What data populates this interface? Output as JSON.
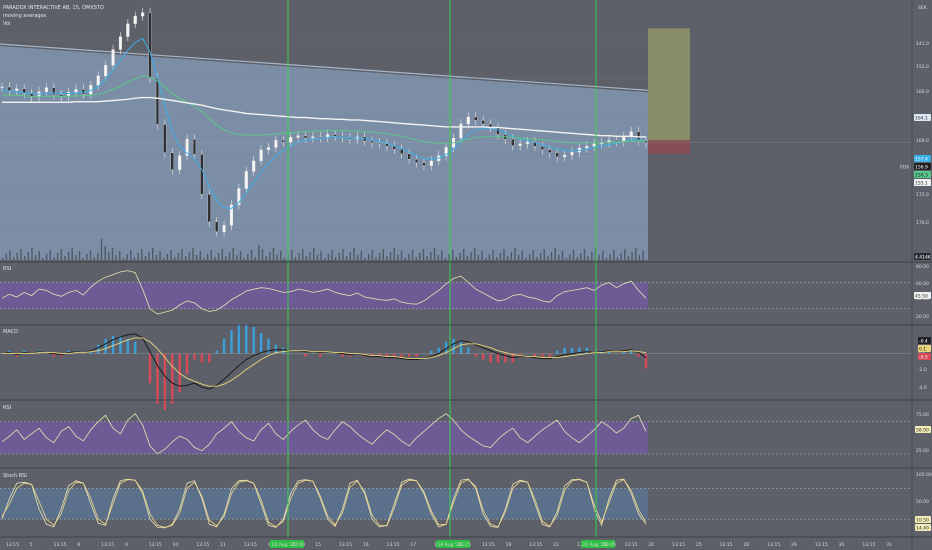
{
  "header": {
    "symbol_line": "PARADOX INTERACTIVE AB, 15, OMXSTO",
    "indicator_1": "moving averages",
    "indicator_2": "Vol",
    "currency": "SEK"
  },
  "chart_data": [
    {
      "pane": "price",
      "type": "candlestick",
      "ylim": [
        137,
        181
      ],
      "yticks": [
        140.0,
        152.0,
        160.0,
        168.0,
        176.0,
        176.0
      ],
      "ytick_labels": [
        "141.0",
        "152.0",
        "160.0",
        "168.0",
        "172.0",
        "176.0"
      ],
      "series": [
        {
          "name": "close",
          "values": [
            166.5,
            165.9,
            166.2,
            165.4,
            164.8,
            165.7,
            166.4,
            165.2,
            164.9,
            165.6,
            166.1,
            165.3,
            166.8,
            168.4,
            170.2,
            172.9,
            175.1,
            177.3,
            178.6,
            179.2,
            168.0,
            160.1,
            155.3,
            152.4,
            154.8,
            157.6,
            155.0,
            148.2,
            143.5,
            141.8,
            142.9,
            146.4,
            149.2,
            152.1,
            153.9,
            155.8,
            156.2,
            157.4,
            157.1,
            157.9,
            158.2,
            157.8,
            158.0,
            157.9,
            158.4,
            158.1,
            157.8,
            157.6,
            158.0,
            157.3,
            157.0,
            156.8,
            156.4,
            155.9,
            155.1,
            154.2,
            153.6,
            153.1,
            153.9,
            154.8,
            156.2,
            157.8,
            160.2,
            161.4,
            160.8,
            160.2,
            159.6,
            158.4,
            157.6,
            156.5,
            156.8,
            157.2,
            156.4,
            155.8,
            155.3,
            154.6,
            154.9,
            155.4,
            156.1,
            156.4,
            156.8,
            157.0,
            157.4,
            157.2,
            158.1,
            158.9,
            157.3,
            157.0
          ]
        },
        {
          "name": "ma_fast",
          "values": [
            166.0,
            165.8,
            165.7,
            165.5,
            165.4,
            165.3,
            165.4,
            165.5,
            165.4,
            165.4,
            165.5,
            165.6,
            165.9,
            166.6,
            167.8,
            169.4,
            171.0,
            172.8,
            174.1,
            174.8,
            172.5,
            168.2,
            163.4,
            159.0,
            156.4,
            155.2,
            154.3,
            152.4,
            149.5,
            147.2,
            145.9,
            145.8,
            146.8,
            148.5,
            150.3,
            152.0,
            153.5,
            154.8,
            155.7,
            156.5,
            157.1,
            157.4,
            157.6,
            157.7,
            157.9,
            158.0,
            157.9,
            157.8,
            157.8,
            157.7,
            157.5,
            157.2,
            156.9,
            156.5,
            156.0,
            155.4,
            154.8,
            154.3,
            154.2,
            154.4,
            155.0,
            155.9,
            157.2,
            158.4,
            159.2,
            159.5,
            159.5,
            159.2,
            158.7,
            158.1,
            157.6,
            157.3,
            157.0,
            156.7,
            156.3,
            155.9,
            155.7,
            155.6,
            155.7,
            155.9,
            156.2,
            156.4,
            156.7,
            156.9,
            157.2,
            157.6,
            157.5,
            157.3
          ]
        },
        {
          "name": "ma_mid",
          "values": [
            165.2,
            165.1,
            165.1,
            165.0,
            164.9,
            164.9,
            164.9,
            164.9,
            164.9,
            164.9,
            165.0,
            165.0,
            165.1,
            165.3,
            165.6,
            166.1,
            166.6,
            167.3,
            167.9,
            168.4,
            168.2,
            167.5,
            166.5,
            165.4,
            164.5,
            163.9,
            163.2,
            162.3,
            161.1,
            160.0,
            159.2,
            158.7,
            158.4,
            158.3,
            158.3,
            158.3,
            158.4,
            158.5,
            158.6,
            158.7,
            158.8,
            158.9,
            159.0,
            159.0,
            159.1,
            159.1,
            159.1,
            159.0,
            159.0,
            158.9,
            158.8,
            158.7,
            158.5,
            158.3,
            158.1,
            157.8,
            157.5,
            157.2,
            157.0,
            156.9,
            156.9,
            157.0,
            157.3,
            157.6,
            157.9,
            158.0,
            158.1,
            158.1,
            158.0,
            157.9,
            157.8,
            157.7,
            157.6,
            157.5,
            157.4,
            157.2,
            157.1,
            157.0,
            157.0,
            157.0,
            157.0,
            157.0,
            157.1,
            157.1,
            157.2,
            157.3,
            157.3,
            157.3
          ]
        },
        {
          "name": "ma_slow",
          "values": [
            163.9,
            163.9,
            163.9,
            163.9,
            163.9,
            163.9,
            163.9,
            163.9,
            163.9,
            163.9,
            164.0,
            164.0,
            164.0,
            164.0,
            164.1,
            164.2,
            164.3,
            164.4,
            164.6,
            164.7,
            164.7,
            164.6,
            164.4,
            164.2,
            164.0,
            163.8,
            163.6,
            163.4,
            163.1,
            162.8,
            162.6,
            162.4,
            162.2,
            162.0,
            161.9,
            161.8,
            161.7,
            161.6,
            161.5,
            161.4,
            161.3,
            161.3,
            161.2,
            161.1,
            161.1,
            161.0,
            161.0,
            160.9,
            160.9,
            160.8,
            160.7,
            160.6,
            160.5,
            160.4,
            160.3,
            160.2,
            160.1,
            160.0,
            159.9,
            159.8,
            159.7,
            159.7,
            159.7,
            159.7,
            159.7,
            159.7,
            159.6,
            159.6,
            159.5,
            159.4,
            159.3,
            159.2,
            159.1,
            159.0,
            158.9,
            158.8,
            158.7,
            158.6,
            158.5,
            158.4,
            158.3,
            158.2,
            158.2,
            158.1,
            158.1,
            158.1,
            158.0,
            158.0
          ]
        }
      ],
      "price_labels": {
        "current": "156.9",
        "target": "164.1",
        "ma": "157.4",
        "green": "156.3",
        "stop": "155.1",
        "symbol_tag": "PDX",
        "volume": "4.414K"
      }
    },
    {
      "pane": "rsi_like",
      "type": "line",
      "ylim": [
        0,
        100
      ],
      "band": [
        30,
        70
      ],
      "ytick_labels": [
        "80.00",
        "60.00",
        "40.00",
        "20.00"
      ],
      "value_label": "45.50",
      "values": [
        46,
        52,
        48,
        55,
        50,
        60,
        58,
        52,
        49,
        55,
        58,
        51,
        63,
        72,
        78,
        82,
        86,
        88,
        85,
        60,
        30,
        22,
        25,
        28,
        36,
        42,
        39,
        30,
        26,
        28,
        35,
        44,
        50,
        57,
        60,
        62,
        61,
        58,
        55,
        56,
        60,
        58,
        55,
        57,
        60,
        55,
        52,
        50,
        54,
        48,
        46,
        44,
        43,
        45,
        40,
        38,
        37,
        42,
        50,
        58,
        68,
        76,
        80,
        70,
        60,
        54,
        48,
        42,
        44,
        50,
        52,
        48,
        46,
        42,
        40,
        50,
        56,
        58,
        60,
        62,
        58,
        66,
        70,
        62,
        68,
        72,
        58,
        46
      ]
    },
    {
      "pane": "macd",
      "type": "line",
      "title": "MACD",
      "ytick_labels": [
        "0.0",
        "-2.0",
        "-4.0"
      ],
      "value_labels": [
        "-0.4",
        "0.1",
        "-0.5"
      ],
      "series": [
        {
          "name": "macd",
          "values": [
            0.0,
            0.1,
            -0.1,
            0.1,
            0.0,
            0.2,
            0.1,
            0.0,
            -0.1,
            0.1,
            0.2,
            0.1,
            0.3,
            0.6,
            1.0,
            1.4,
            1.7,
            1.9,
            2.0,
            1.6,
            0.2,
            -1.2,
            -2.3,
            -3.0,
            -3.3,
            -3.2,
            -3.0,
            -3.4,
            -3.6,
            -3.2,
            -2.6,
            -1.9,
            -1.2,
            -0.6,
            -0.2,
            0.1,
            0.3,
            0.4,
            0.4,
            0.3,
            0.3,
            0.2,
            0.2,
            0.1,
            0.2,
            0.1,
            0.0,
            -0.1,
            0.0,
            -0.2,
            -0.3,
            -0.3,
            -0.4,
            -0.4,
            -0.5,
            -0.6,
            -0.6,
            -0.5,
            -0.3,
            0.0,
            0.5,
            1.0,
            1.3,
            1.2,
            0.9,
            0.6,
            0.3,
            0.0,
            -0.2,
            -0.4,
            -0.3,
            -0.3,
            -0.4,
            -0.5,
            -0.5,
            -0.3,
            -0.1,
            0.0,
            0.1,
            0.2,
            0.1,
            0.2,
            0.3,
            0.2,
            0.3,
            0.4,
            0.1,
            -0.4
          ]
        },
        {
          "name": "signal",
          "values": [
            0.0,
            0.0,
            0.0,
            0.0,
            0.0,
            0.1,
            0.1,
            0.1,
            0.0,
            0.0,
            0.1,
            0.1,
            0.2,
            0.3,
            0.5,
            0.8,
            1.1,
            1.4,
            1.6,
            1.6,
            1.2,
            0.5,
            -0.4,
            -1.3,
            -2.0,
            -2.5,
            -2.8,
            -3.1,
            -3.3,
            -3.3,
            -3.1,
            -2.7,
            -2.2,
            -1.6,
            -1.1,
            -0.6,
            -0.2,
            0.1,
            0.2,
            0.3,
            0.3,
            0.3,
            0.2,
            0.2,
            0.2,
            0.1,
            0.1,
            0.0,
            0.0,
            -0.1,
            -0.2,
            -0.2,
            -0.3,
            -0.3,
            -0.4,
            -0.5,
            -0.5,
            -0.5,
            -0.4,
            -0.2,
            0.1,
            0.5,
            0.9,
            1.0,
            1.0,
            0.8,
            0.6,
            0.3,
            0.1,
            -0.1,
            -0.2,
            -0.3,
            -0.3,
            -0.4,
            -0.4,
            -0.4,
            -0.3,
            -0.2,
            -0.1,
            0.0,
            0.1,
            0.1,
            0.2,
            0.2,
            0.2,
            0.3,
            0.2,
            0.1
          ]
        }
      ]
    },
    {
      "pane": "rsi",
      "type": "line",
      "title": "RSI",
      "band": [
        30,
        70
      ],
      "ytick_labels": [
        "75.00",
        "50.00",
        "25.00"
      ],
      "value_label": "58.00",
      "values": [
        45,
        52,
        60,
        48,
        55,
        62,
        50,
        44,
        58,
        64,
        52,
        46,
        60,
        70,
        78,
        62,
        55,
        72,
        80,
        66,
        40,
        30,
        36,
        45,
        52,
        48,
        38,
        34,
        42,
        55,
        62,
        70,
        58,
        50,
        46,
        60,
        68,
        55,
        48,
        58,
        66,
        72,
        60,
        52,
        48,
        60,
        70,
        64,
        55,
        48,
        42,
        52,
        60,
        54,
        46,
        40,
        50,
        58,
        66,
        74,
        80,
        72,
        60,
        52,
        46,
        40,
        38,
        48,
        56,
        62,
        50,
        44,
        52,
        60,
        66,
        72,
        58,
        50,
        44,
        52,
        60,
        70,
        64,
        56,
        62,
        74,
        78,
        58
      ]
    },
    {
      "pane": "stoch_rsi",
      "type": "line",
      "title": "Stoch RSI",
      "band": [
        20,
        80
      ],
      "ytick_labels": [
        "100.00",
        "50.00",
        "0.00"
      ],
      "value_labels": [
        "10.50",
        "14.40"
      ],
      "series": [
        {
          "name": "k",
          "values": [
            20,
            60,
            90,
            92,
            88,
            40,
            10,
            5,
            40,
            85,
            95,
            90,
            50,
            12,
            8,
            60,
            95,
            98,
            96,
            70,
            20,
            4,
            3,
            10,
            40,
            90,
            95,
            60,
            10,
            5,
            30,
            80,
            95,
            96,
            90,
            50,
            8,
            4,
            20,
            70,
            95,
            97,
            94,
            60,
            20,
            6,
            40,
            90,
            96,
            70,
            20,
            5,
            8,
            50,
            92,
            98,
            95,
            70,
            30,
            5,
            10,
            60,
            96,
            98,
            80,
            30,
            6,
            4,
            40,
            88,
            96,
            92,
            50,
            10,
            5,
            35,
            85,
            97,
            98,
            92,
            40,
            8,
            60,
            96,
            98,
            70,
            30,
            10
          ]
        },
        {
          "name": "d",
          "values": [
            25,
            50,
            80,
            90,
            88,
            55,
            20,
            8,
            30,
            75,
            92,
            90,
            60,
            20,
            10,
            50,
            90,
            97,
            96,
            75,
            30,
            8,
            4,
            8,
            32,
            80,
            92,
            65,
            18,
            7,
            25,
            70,
            92,
            95,
            90,
            58,
            14,
            5,
            16,
            60,
            90,
            96,
            94,
            65,
            26,
            9,
            32,
            82,
            94,
            74,
            28,
            8,
            7,
            42,
            86,
            96,
            95,
            74,
            36,
            9,
            10,
            52,
            90,
            97,
            84,
            38,
            10,
            5,
            34,
            80,
            94,
            92,
            58,
            16,
            6,
            28,
            76,
            95,
            97,
            92,
            48,
            14,
            52,
            90,
            97,
            76,
            38,
            14
          ]
        }
      ]
    }
  ],
  "x_axis": {
    "ticks": [
      "13:15",
      "5",
      "13:15",
      "8",
      "13:15",
      "9",
      "13:15",
      "10",
      "13:15",
      "11",
      "13:15",
      "12",
      "13:15",
      "15",
      "13:15",
      "16",
      "13:15",
      "17",
      "13:15",
      "18",
      "13:15",
      "19",
      "13:15",
      "22",
      "13:15",
      "23",
      "13:15",
      "24",
      "13:15",
      "25",
      "13:15",
      "26",
      "13:15",
      "29",
      "13:15",
      "30",
      "13:15",
      "31"
    ],
    "highlights": [
      "12 Aug '21",
      "17:00",
      "18 Aug '21",
      "10:15",
      "22 Aug '21",
      "09:45"
    ]
  },
  "colors": {
    "background": "#5d6068",
    "price_band": "#7f93ad",
    "ma_fast": "#3ab0e8",
    "ma_mid": "#58c78b",
    "ma_slow": "#f2f2f2",
    "candle": "#e8e8e8",
    "oscillator_band": "#6f5a9c",
    "stoch_band": "#5a7492",
    "osc_line": "#e9e2b2",
    "cursor": "#37d14a",
    "macd_pos": "#3aa0d8",
    "macd_neg": "#d84a5a"
  }
}
